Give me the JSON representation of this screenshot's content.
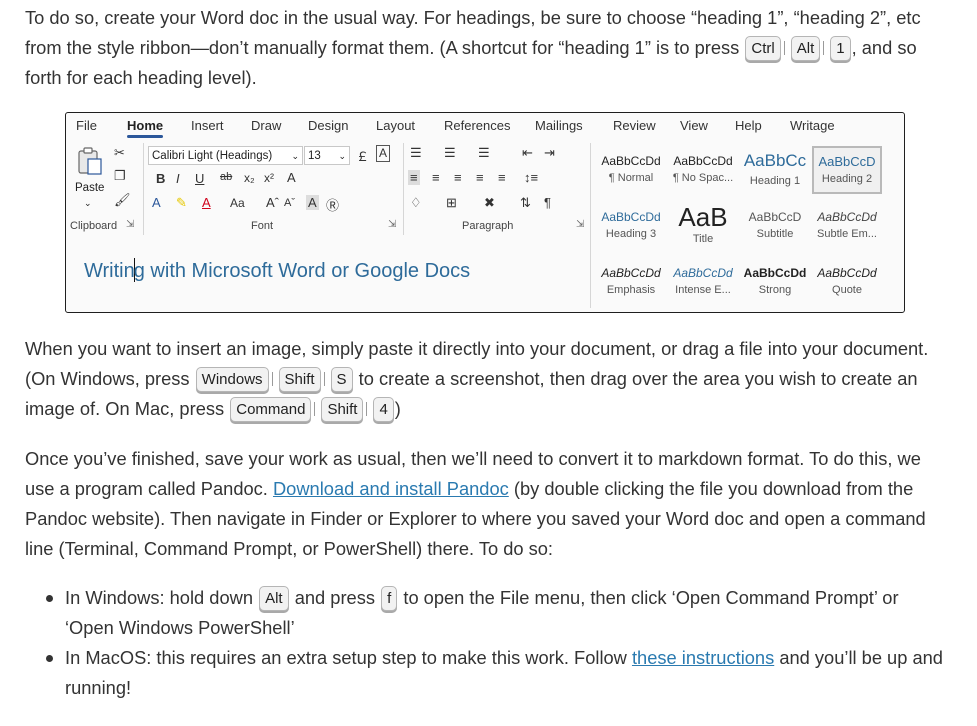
{
  "para1": {
    "text_a": "To do so, create your Word doc in the usual way. For headings, be sure to choose “heading 1”, “heading 2”, etc from the style ribbon—don’t manually format them. (A shortcut for “heading 1” is to press",
    "keys": [
      "Ctrl",
      "Alt",
      "1"
    ],
    "text_b": ", and so forth for each heading level)."
  },
  "ribbon": {
    "tabs": [
      "File",
      "Home",
      "Insert",
      "Draw",
      "Design",
      "Layout",
      "References",
      "Mailings",
      "Review",
      "View",
      "Help",
      "Writage"
    ],
    "active_tab": "Home",
    "font_name": "Calibri Light (Headings)",
    "font_size": "13",
    "paste_label": "Paste",
    "groups": [
      "Clipboard",
      "Font",
      "Paragraph"
    ],
    "doc_text_a": "Writin",
    "doc_text_b": "g with Microsoft Word or Google Docs",
    "styles": [
      {
        "sample": "AaBbCcDd",
        "name": "¶ Normal"
      },
      {
        "sample": "AaBbCcDd",
        "name": "¶ No Spac..."
      },
      {
        "sample": "AaBbCc",
        "name": "Heading 1"
      },
      {
        "sample": "AaBbCcD",
        "name": "Heading 2"
      },
      {
        "sample": "AaBbCcDd",
        "name": "Heading 3"
      },
      {
        "sample": "AaB",
        "name": "Title"
      },
      {
        "sample": "AaBbCcD",
        "name": "Subtitle"
      },
      {
        "sample": "AaBbCcDd",
        "name": "Subtle Em..."
      },
      {
        "sample": "AaBbCcDd",
        "name": "Emphasis"
      },
      {
        "sample": "AaBbCcDd",
        "name": "Intense E..."
      },
      {
        "sample": "AaBbCcDd",
        "name": "Strong"
      },
      {
        "sample": "AaBbCcDd",
        "name": "Quote"
      }
    ]
  },
  "para2": {
    "text_a": "When you want to insert an image, simply paste it directly into your document, or drag a file into your document. (On Windows, press",
    "keys_win": [
      "Windows",
      "Shift",
      "S"
    ],
    "text_b": "to create a screenshot, then drag over the area you wish to create an image of. On Mac, press",
    "keys_mac": [
      "Command",
      "Shift",
      "4"
    ],
    "text_c": ")"
  },
  "para3": {
    "text_a": "Once you’ve finished, save your work as usual, then we’ll need to convert it to markdown format. To do this, we use a program called Pandoc.",
    "link": "Download and install Pandoc",
    "text_b": "(by double clicking the file you download from the Pandoc website). Then navigate in Finder or Explorer to where you saved your Word doc and open a command line (Terminal, Command Prompt, or PowerShell) there. To do so:"
  },
  "bullets": {
    "b1_a": "In Windows: hold down",
    "b1_key1": "Alt",
    "b1_b": "and press",
    "b1_key2": "f",
    "b1_c": "to open the File menu, then click ‘Open Command Prompt’ or ‘Open Windows PowerShell’",
    "b2_a": "In MacOS: this requires an extra setup step to make this work. Follow",
    "b2_link": "these instructions",
    "b2_b": "and you’ll be up and running!"
  },
  "colors": {
    "link": "#2a7ab0",
    "word_accent": "#2b579a",
    "doc_heading": "#2e6b9a"
  },
  "icons": [
    "paste-icon",
    "cut-icon",
    "copy-icon",
    "format-painter-icon",
    "bold-icon",
    "italic-icon",
    "underline-icon",
    "bullets-icon",
    "numbering-icon",
    "align-left-icon",
    "sort-icon",
    "pilcrow-icon"
  ]
}
